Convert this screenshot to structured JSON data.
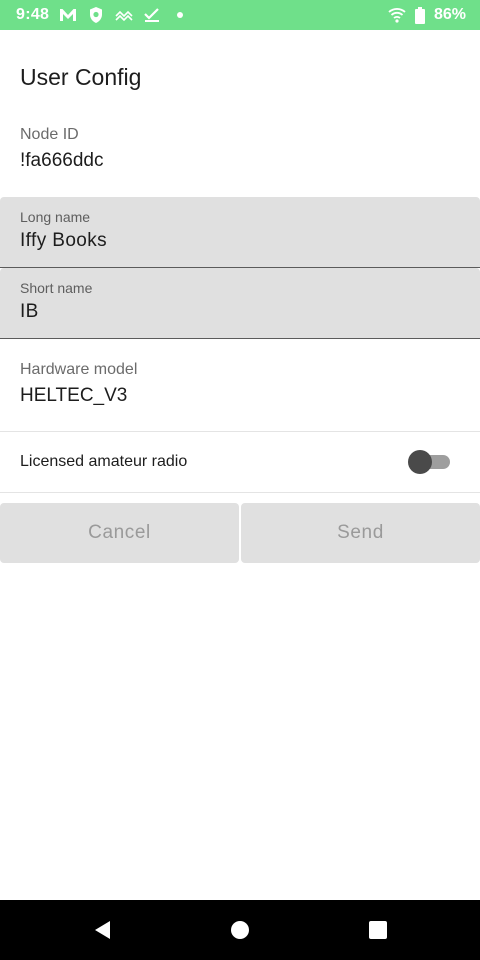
{
  "status_bar": {
    "time": "9:48",
    "battery": "86%",
    "icons": [
      "gmail-icon",
      "vpn-shield-icon",
      "swap-icon",
      "check-icon",
      "dot-icon",
      "wifi-icon",
      "battery-icon"
    ],
    "background": "#6fe08a"
  },
  "page": {
    "title": "User Config"
  },
  "node_id": {
    "label": "Node ID",
    "value": "!fa666ddc"
  },
  "long_name": {
    "label": "Long name",
    "value": "Iffy Books"
  },
  "short_name": {
    "label": "Short name",
    "value": "IB"
  },
  "hardware_model": {
    "label": "Hardware model",
    "value": "HELTEC_V3"
  },
  "licensed_radio": {
    "label": "Licensed amateur radio",
    "checked": false
  },
  "actions": {
    "cancel_label": "Cancel",
    "send_label": "Send"
  },
  "nav": {
    "icons": [
      "back-icon",
      "home-icon",
      "recents-icon"
    ]
  }
}
